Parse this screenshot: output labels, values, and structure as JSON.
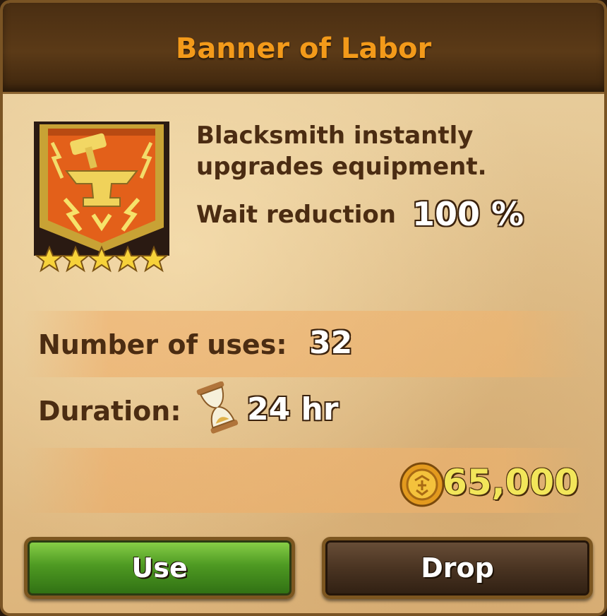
{
  "dialog": {
    "title": "Banner of Labor",
    "item_icon": "banner-anvil-icon",
    "stars": 5,
    "description_line1": "Blacksmith instantly",
    "description_line2": "upgrades equipment.",
    "wait_label": "Wait reduction",
    "wait_value": "100 %",
    "uses_label": "Number of uses:",
    "uses_value": "32",
    "duration_label": "Duration:",
    "duration_icon": "hourglass-icon",
    "duration_value": "24 hr",
    "price_icon": "gold-coin-icon",
    "price_value": "65,000",
    "use_button": "Use",
    "drop_button": "Drop"
  },
  "colors": {
    "title": "#f39a1a",
    "text": "#4b2c12",
    "price": "#f2e65a",
    "use_button": "#4e9a22",
    "drop_button": "#4a3422"
  }
}
